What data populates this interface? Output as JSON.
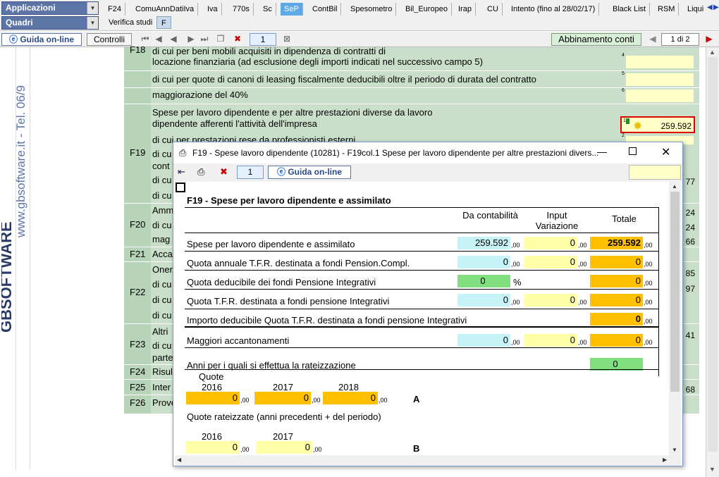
{
  "top": {
    "app_dropdown": "Applicazioni",
    "quadri_dropdown": "Quadri",
    "tabs": [
      "F24",
      "ComuAnnDatiIva",
      "Iva",
      "770s",
      "Sc",
      "SeP",
      "ContBil",
      "Spesometro",
      "Bil_Europeo",
      "Irap",
      "CU",
      "Intento (fino al 28/02/17)",
      "Black List",
      "RSM",
      "Liqui"
    ],
    "active_tab": "SeP",
    "subtabs": [
      "Verifica studi",
      "F"
    ]
  },
  "toolbar": {
    "guida": "Guida on-line",
    "controlli": "Controlli",
    "page_number": "1",
    "abbinamento": "Abbinamento conti",
    "page_of": "1 di 2"
  },
  "sidebar": {
    "brand": "GBSOFTWARE",
    "vertical_text": "www.gbsoftware.it - Tel. 06/9"
  },
  "bg_form": {
    "rows": [
      {
        "code": "F18",
        "text1": "di cui per beni mobili acquisiti in dipendenza di contratti di",
        "text2": "locazione finanziaria (ad esclusione degli importi indicati nel successivo campo 5)",
        "col": "4",
        "value": ""
      },
      {
        "code": "",
        "text1": "di cui per quote di canoni di leasing fiscalmente deducibili oltre il periodo di durata del contratto",
        "text2": "",
        "col": "5",
        "value": ""
      },
      {
        "code": "",
        "text1": "maggiorazione del 40%",
        "text2": "",
        "col": "6",
        "value": ""
      },
      {
        "code": "",
        "text1": "Spese per lavoro dipendente e per altre prestazioni diverse da lavoro",
        "text2": "dipendente afferenti l'attività dell'impresa",
        "col": "1",
        "value": "259.592"
      },
      {
        "code": "F19",
        "text1": "di cui per prestazioni rese da professionisti esterni",
        "text2": "",
        "col": "2",
        "value": ""
      }
    ],
    "partial_labels": [
      {
        "code": "",
        "text": "di cu"
      },
      {
        "code": "",
        "text": "cont"
      },
      {
        "code": "",
        "text": "di cu"
      },
      {
        "code": "",
        "text": "di cu"
      },
      {
        "code": "F20",
        "text": "Amm"
      },
      {
        "code": "",
        "text": "di cu"
      },
      {
        "code": "",
        "text": "mag"
      },
      {
        "code": "F21",
        "text": "Acca"
      },
      {
        "code": "F22",
        "text": "Oner"
      },
      {
        "code": "",
        "text": "di cu"
      },
      {
        "code": "",
        "text": "di cu"
      },
      {
        "code": "",
        "text": "di cu"
      },
      {
        "code": "F23",
        "text": "Altri"
      },
      {
        "code": "",
        "text": "di cu"
      },
      {
        "code": "",
        "text": "parte"
      },
      {
        "code": "F24",
        "text": "Risul"
      },
      {
        "code": "F25",
        "text": "Inter"
      },
      {
        "code": "F26",
        "text": "Prove"
      }
    ],
    "right_values": [
      "77",
      "24",
      "24",
      "66",
      "85",
      "97",
      "41",
      "68"
    ]
  },
  "dialog": {
    "title": "F19 - Spese lavoro dipendente (10281) - F19col.1 Spese per lavoro dipendente per altre prestazioni divers...",
    "toolbar_number": "1",
    "guida": "Guida on-line",
    "heading": "F19 - Spese per lavoro dipendente e assimilato",
    "col_headers": [
      "Da contabilità",
      "Input Variazione",
      "Totale"
    ],
    "dec_suffix": ",00",
    "rows": [
      {
        "label": "Spese per lavoro dipendente e assimilato",
        "da": "259.592",
        "input": "0",
        "totale": "259.592"
      },
      {
        "label": "Quota annuale T.F.R. destinata a fondi Pension.Compl.",
        "da": "0",
        "input": "0",
        "totale": "0"
      },
      {
        "label": "Quota deducibile dei fondi Pensione Integrativi",
        "da": "0",
        "pct": "%",
        "input": "",
        "totale": "0"
      },
      {
        "label": "Quota T.F.R. destinata a fondi pensione Integrativi",
        "da": "0",
        "input": "0",
        "totale": "0"
      },
      {
        "label": "Importo deducibile Quota T.F.R. destinata a fondi pensione Integrativi",
        "da": "",
        "input": "",
        "totale": "0"
      },
      {
        "label": "Maggiori accantonamenti",
        "da": "0",
        "input": "0",
        "totale": "0"
      }
    ],
    "anni_label": "Anni per i quali si effettua la rateizzazione",
    "anni_value": "0",
    "quote_label": "Quote",
    "quote_years": [
      "2016",
      "2017",
      "2018"
    ],
    "quote_values": [
      "0",
      "0",
      "0"
    ],
    "quote_tag": "A",
    "rateizzate_label": "Quote rateizzate  (anni precedenti + del periodo)",
    "rat_years": [
      "2016",
      "2017"
    ],
    "rat_values": [
      "0",
      "0"
    ],
    "rat_tag": "B"
  }
}
